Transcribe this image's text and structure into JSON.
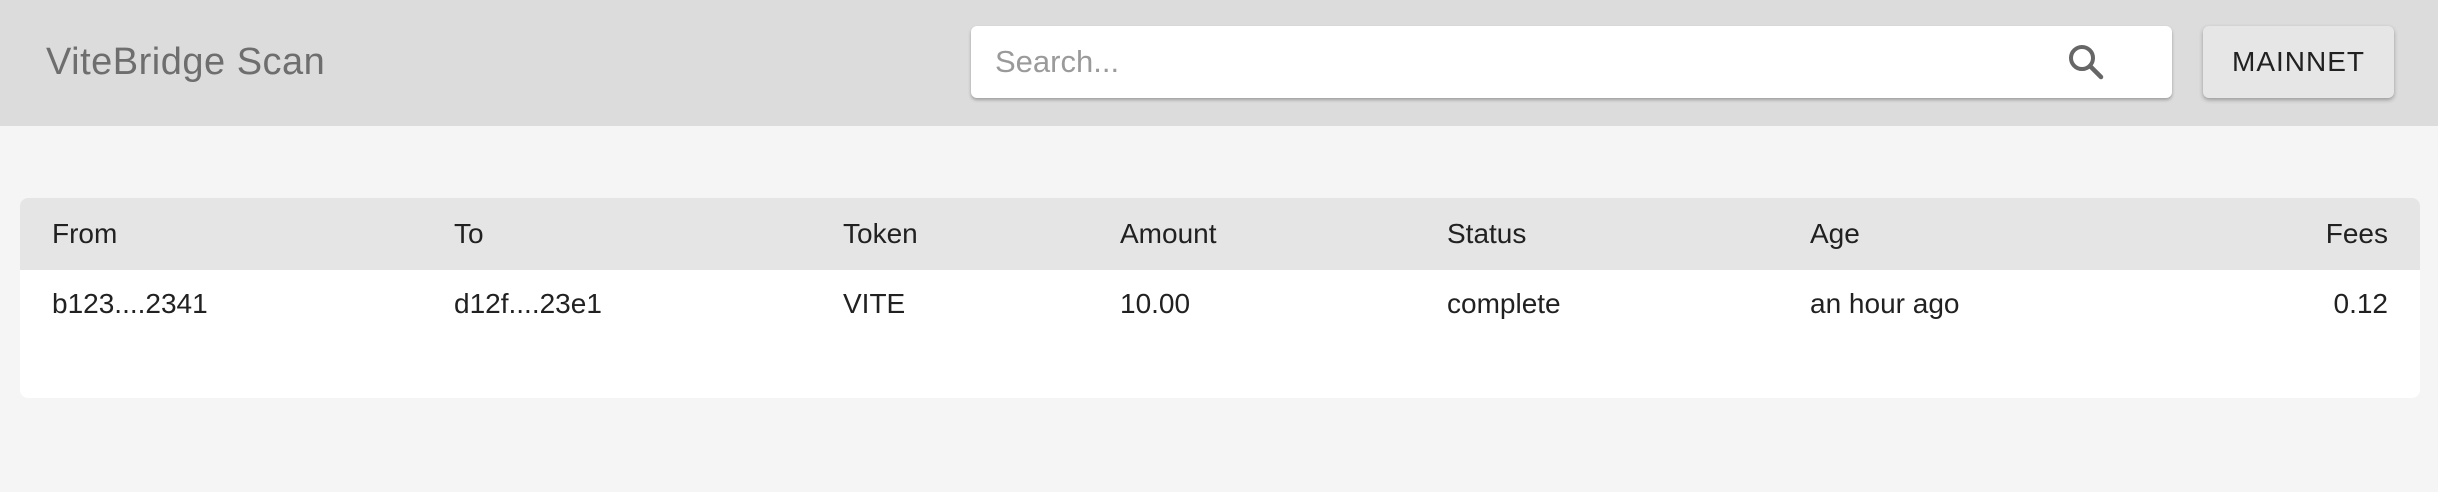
{
  "app": {
    "title": "ViteBridge Scan"
  },
  "search": {
    "placeholder": "Search...",
    "value": "",
    "icon": "search-icon"
  },
  "network": {
    "label": "MAINNET"
  },
  "table": {
    "columns": [
      "From",
      "To",
      "Token",
      "Amount",
      "Status",
      "Age",
      "Fees"
    ],
    "rows": [
      {
        "from": "b123....2341",
        "to": "d12f....23e1",
        "token": "VITE",
        "amount": "10.00",
        "status": "complete",
        "age": "an hour ago",
        "fees": "0.12"
      }
    ]
  },
  "colors": {
    "app_bar": "#dcdcdc",
    "page_background": "#f5f5f5",
    "table_header": "#e5e5e5",
    "card": "#ffffff"
  }
}
